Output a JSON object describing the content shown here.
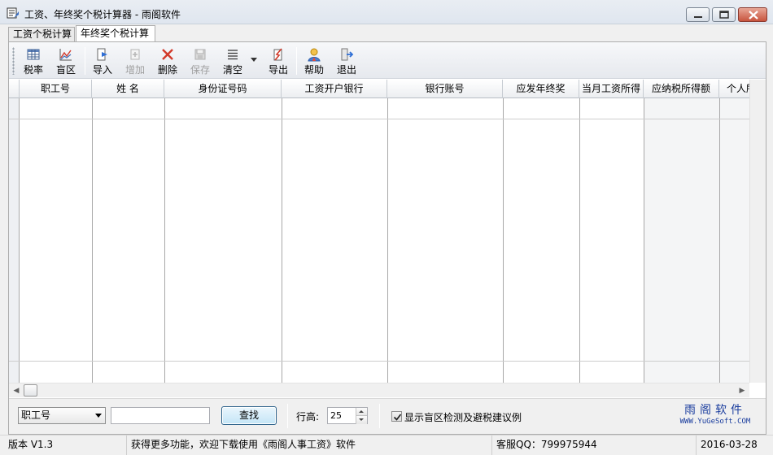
{
  "window": {
    "title": "工资、年终奖个税计算器 - 雨阁软件"
  },
  "tabs": [
    {
      "label": "工资个税计算",
      "active": false
    },
    {
      "label": "年终奖个税计算",
      "active": true
    }
  ],
  "toolbar": {
    "items": [
      {
        "label": "税率",
        "icon": "table-icon",
        "enabled": true
      },
      {
        "label": "盲区",
        "icon": "chart-icon",
        "enabled": true
      },
      {
        "label": "导入",
        "icon": "import-icon",
        "enabled": true
      },
      {
        "label": "增加",
        "icon": "add-icon",
        "enabled": false
      },
      {
        "label": "删除",
        "icon": "delete-icon",
        "enabled": true
      },
      {
        "label": "保存",
        "icon": "save-icon",
        "enabled": false
      },
      {
        "label": "清空",
        "icon": "clear-icon",
        "enabled": true
      },
      {
        "label": "导出",
        "icon": "export-icon",
        "enabled": true
      },
      {
        "label": "帮助",
        "icon": "help-icon",
        "enabled": true
      },
      {
        "label": "退出",
        "icon": "exit-icon",
        "enabled": true
      }
    ]
  },
  "grid": {
    "columns": [
      "职工号",
      "姓  名",
      "身份证号码",
      "工资开户银行",
      "银行账号",
      "应发年终奖",
      "当月工资所得",
      "应纳税所得额",
      "个人所"
    ],
    "rows": []
  },
  "search": {
    "field_selected": "职工号",
    "query": "",
    "find_label": "查找"
  },
  "row_height": {
    "label": "行高:",
    "value": "25"
  },
  "blind_zone": {
    "label": "显示盲区检测及避税建议例",
    "checked": true
  },
  "brand": {
    "name": "雨阁软件",
    "site": "WWW.YuGeSoft.COM"
  },
  "status": {
    "version": "版本 V1.3",
    "promo": "获得更多功能，欢迎下载使用《雨阁人事工资》软件",
    "support": "客服QQ：799975944",
    "date": "2016-03-28"
  },
  "colors": {
    "accent": "#1a3d9e",
    "find_button_border": "#2c628b"
  }
}
